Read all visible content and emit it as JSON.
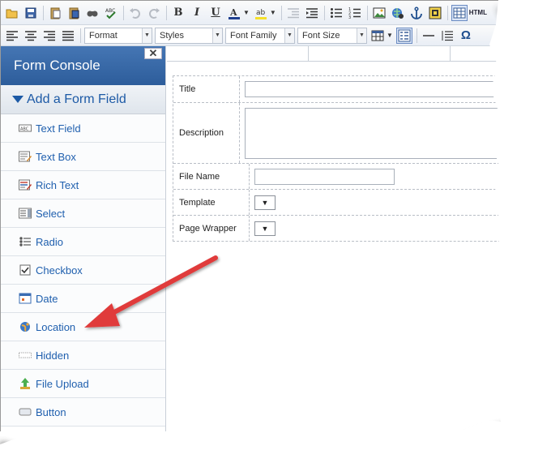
{
  "toolbar_row1": {
    "buttons": [
      "open-folder-icon",
      "save-icon",
      "paste-icon",
      "paste-word-icon",
      "find-icon",
      "spellcheck-icon",
      "undo-icon",
      "redo-icon",
      "bold-icon",
      "italic-icon",
      "underline-icon",
      "font-color-icon",
      "highlight-icon",
      "outdent-icon",
      "indent-icon",
      "bulleted-list-icon",
      "numbered-list-icon",
      "image-icon",
      "hyperlink-icon",
      "anchor-icon",
      "media-icon",
      "table-view-icon",
      "html-view-icon"
    ],
    "html_label": "HTML"
  },
  "toolbar_row2": {
    "format_label": "Format",
    "styles_label": "Styles",
    "font_family_label": "Font Family",
    "font_size_label": "Font Size"
  },
  "sidebar": {
    "title": "Form Console",
    "close_label": "✕",
    "section_title": "Add a Form Field",
    "items": [
      {
        "label": "Text Field",
        "icon": "text-field-icon"
      },
      {
        "label": "Text Box",
        "icon": "text-box-icon"
      },
      {
        "label": "Rich Text",
        "icon": "rich-text-icon"
      },
      {
        "label": "Select",
        "icon": "select-icon"
      },
      {
        "label": "Radio",
        "icon": "radio-icon"
      },
      {
        "label": "Checkbox",
        "icon": "checkbox-icon"
      },
      {
        "label": "Date",
        "icon": "date-icon"
      },
      {
        "label": "Location",
        "icon": "location-icon"
      },
      {
        "label": "Hidden",
        "icon": "hidden-icon"
      },
      {
        "label": "File Upload",
        "icon": "file-upload-icon"
      },
      {
        "label": "Button",
        "icon": "button-icon"
      }
    ]
  },
  "form": {
    "rows": [
      {
        "label": "Title"
      },
      {
        "label": "Description"
      },
      {
        "label": "File Name"
      },
      {
        "label": "Template",
        "select_value": "▼"
      },
      {
        "label": "Page Wrapper",
        "select_value": "▼"
      }
    ]
  },
  "annotation": {
    "arrow_color": "#e03a3a"
  }
}
